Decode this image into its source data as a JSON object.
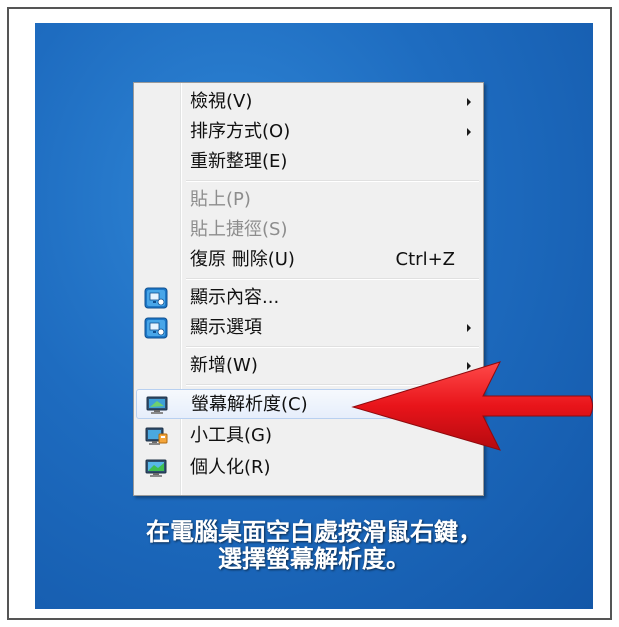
{
  "menu": {
    "items": [
      {
        "label": "檢視(V)",
        "submenu": true
      },
      {
        "label": "排序方式(O)",
        "submenu": true
      },
      {
        "label": "重新整理(E)"
      },
      {
        "label": "貼上(P)",
        "disabled": true
      },
      {
        "label": "貼上捷徑(S)",
        "disabled": true
      },
      {
        "label": "復原 刪除(U)",
        "shortcut": "Ctrl+Z"
      },
      {
        "label": "顯示內容...",
        "icon": "intel-graphics-icon"
      },
      {
        "label": "顯示選項",
        "icon": "intel-graphics-icon",
        "submenu": true
      },
      {
        "label": "新增(W)",
        "submenu": true
      },
      {
        "label": "螢幕解析度(C)",
        "icon": "monitor-icon",
        "highlighted": true
      },
      {
        "label": "小工具(G)",
        "icon": "gadgets-icon"
      },
      {
        "label": "個人化(R)",
        "icon": "personalize-icon"
      }
    ]
  },
  "caption": {
    "line1": "在電腦桌面空白處按滑鼠右鍵，",
    "line2": "選擇螢幕解析度。"
  },
  "colors": {
    "desktop": "#1e6cc0",
    "menu_bg": "#f0f0f0",
    "arrow": "#e8141a",
    "caption": "#ffffff"
  }
}
